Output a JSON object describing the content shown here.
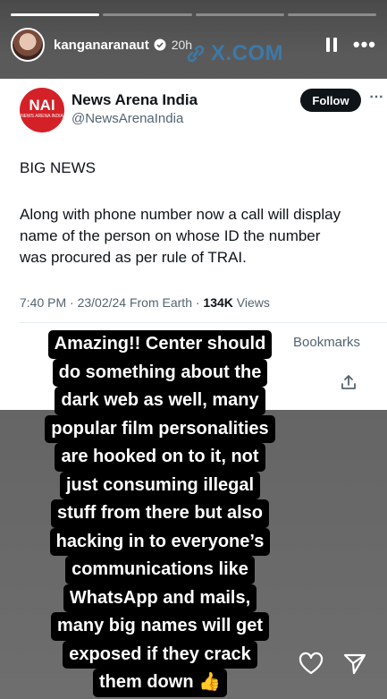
{
  "story": {
    "username": "kanganaranaut",
    "time": "20h",
    "progress": [
      1,
      0,
      0,
      0
    ],
    "more_glyph": "•••",
    "overlay_link": "X.COM"
  },
  "tweet": {
    "logo_text": "NAI",
    "logo_subtext": "NEWS ARENA INDIA",
    "account_name": "News Arena India",
    "handle": "@NewsArenaIndia",
    "follow_label": "Follow",
    "headline": "BIG NEWS",
    "body_lines": [
      "Along with phone number now a call will display",
      "name of the person on whose ID the number",
      "was procured as per rule of TRAI."
    ],
    "meta_time": "7:40 PM · 23/02/24 From Earth · ",
    "views_count": "134K",
    "views_label": " Views",
    "bookmarks_label": "Bookmarks"
  },
  "caption_lines": [
    "Amazing!! Center should",
    "do something about the",
    "dark web as well, many",
    "popular film personalities",
    "are hooked on to it, not",
    "just consuming illegal",
    "stuff from there but also",
    "hacking in to everyone’s",
    "communications like",
    "WhatsApp and mails,",
    "many big names will get",
    "exposed if they crack",
    "them down 👍"
  ],
  "icons": {
    "verified": "verified-badge-icon",
    "pause": "pause-icon",
    "more": "more-options-icon",
    "link": "link-icon",
    "share": "share-icon",
    "heart": "heart-icon",
    "send": "send-icon"
  },
  "colors": {
    "follow_bg": "#0f1419",
    "logo_bg": "#d42027",
    "link_color": "#3d79a8"
  }
}
